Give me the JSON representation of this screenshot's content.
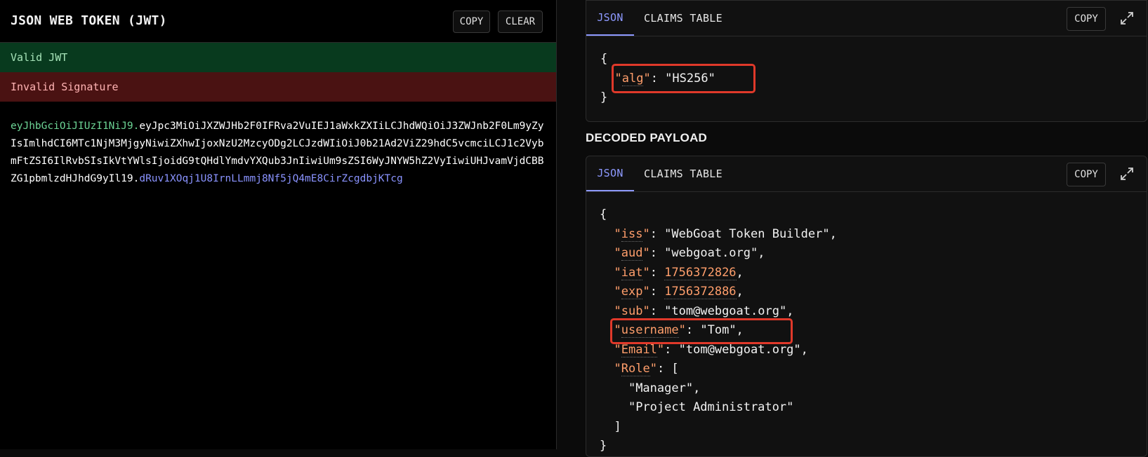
{
  "left": {
    "title": "JSON WEB TOKEN (JWT)",
    "copy_label": "COPY",
    "clear_label": "CLEAR",
    "status_valid": "Valid JWT",
    "status_invalid": "Invalid Signature",
    "token": {
      "header": "eyJhbGciOiJIUzI1NiJ9",
      "payload": "eyJpc3MiOiJXZWJHb2F0IFRva2VuIEJ1aWxkZXIiLCJhdWQiOiJ3ZWJnb2F0Lm9yZyIsImlhdCI6MTc1NjM3MjgyNiwiZXhwIjoxNzU2MzcyODg2LCJzdWIiOiJ0b21Ad2ViZ29hdC5vcmciLCJ1c2VybmFtZSI6IlRvbSIsIkVtYWlsIjoidG9tQHdlYmdvYXQub3JnIiwiUm9sZSI6WyJNYW5hZ2VyIiwiUHJvamVjdCBBZG1pbmlzdHJhdG9yIl19",
      "signature": "dRuv1XOqj1U8IrnLLmmj8Nf5jQ4mE8CirZcgdbjKTcg",
      "dot": "."
    }
  },
  "header_card": {
    "tab_json": "JSON",
    "tab_claims": "CLAIMS TABLE",
    "copy_label": "COPY",
    "json": {
      "alg_key": "alg",
      "alg_value": "HS256"
    }
  },
  "decoded_title": "DECODED PAYLOAD",
  "payload_card": {
    "tab_json": "JSON",
    "tab_claims": "CLAIMS TABLE",
    "copy_label": "COPY",
    "json": {
      "iss_key": "iss",
      "iss_value": "WebGoat Token Builder",
      "aud_key": "aud",
      "aud_value": "webgoat.org",
      "iat_key": "iat",
      "iat_value": "1756372826",
      "exp_key": "exp",
      "exp_value": "1756372886",
      "sub_key": "sub",
      "sub_value": "tom@webgoat.org",
      "username_key": "username",
      "username_value": "Tom",
      "email_key": "Email",
      "email_value": "tom@webgoat.org",
      "role_key": "Role",
      "roles": [
        "Manager",
        "Project Administrator"
      ]
    }
  },
  "colors": {
    "accent": "#8d99ff",
    "valid_bg": "#083a1e",
    "invalid_bg": "#4a1212",
    "highlight": "#e0392a",
    "json_key": "#ff9e6b"
  }
}
